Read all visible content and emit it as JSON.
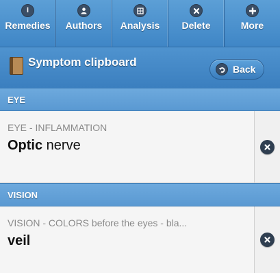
{
  "toolbar": {
    "buttons": [
      {
        "label": "Remedies",
        "icon": "info-icon"
      },
      {
        "label": "Authors",
        "icon": "user-icon"
      },
      {
        "label": "Analysis",
        "icon": "grid-icon"
      },
      {
        "label": "Delete",
        "icon": "delete-icon"
      },
      {
        "label": "More",
        "icon": "plus-icon"
      }
    ]
  },
  "header": {
    "title": "Symptom clipboard",
    "back_label": "Back"
  },
  "sections": [
    {
      "title": "EYE",
      "items": [
        {
          "subtitle": "EYE - INFLAMMATION",
          "title_strong": "Optic",
          "title_rest": " nerve"
        }
      ]
    },
    {
      "title": "VISION",
      "items": [
        {
          "subtitle": "VISION - COLORS before the eyes - bla...",
          "title_strong": "veil",
          "title_rest": ""
        }
      ]
    }
  ],
  "colors": {
    "toolbar": "#4a90cf",
    "section": "#62a0d7",
    "row_bg": "#f5f5f5"
  }
}
